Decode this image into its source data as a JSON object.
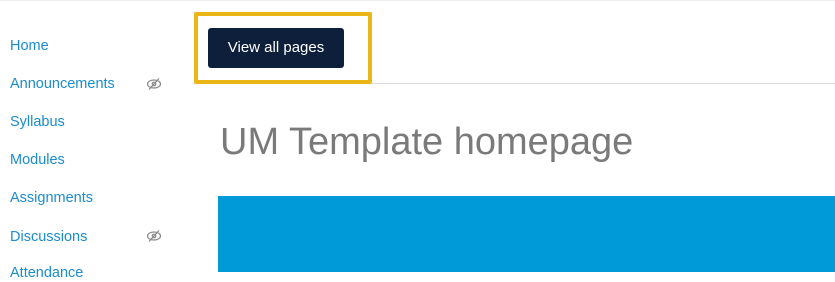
{
  "sidebar": {
    "items": [
      {
        "label": "Home",
        "hidden": false
      },
      {
        "label": "Announcements",
        "hidden": true
      },
      {
        "label": "Syllabus",
        "hidden": false
      },
      {
        "label": "Modules",
        "hidden": false
      },
      {
        "label": "Assignments",
        "hidden": false
      },
      {
        "label": "Discussions",
        "hidden": true
      },
      {
        "label": "Attendance",
        "hidden": false
      }
    ],
    "hidden_icon": "eye-slash-icon"
  },
  "main": {
    "view_all_pages_label": "View all pages",
    "page_title": "UM Template homepage"
  },
  "colors": {
    "link": "#1a8ccf",
    "button_bg": "#0d1f3b",
    "highlight": "#e9b517",
    "banner": "#009ad9",
    "title": "#7a7a7a"
  }
}
